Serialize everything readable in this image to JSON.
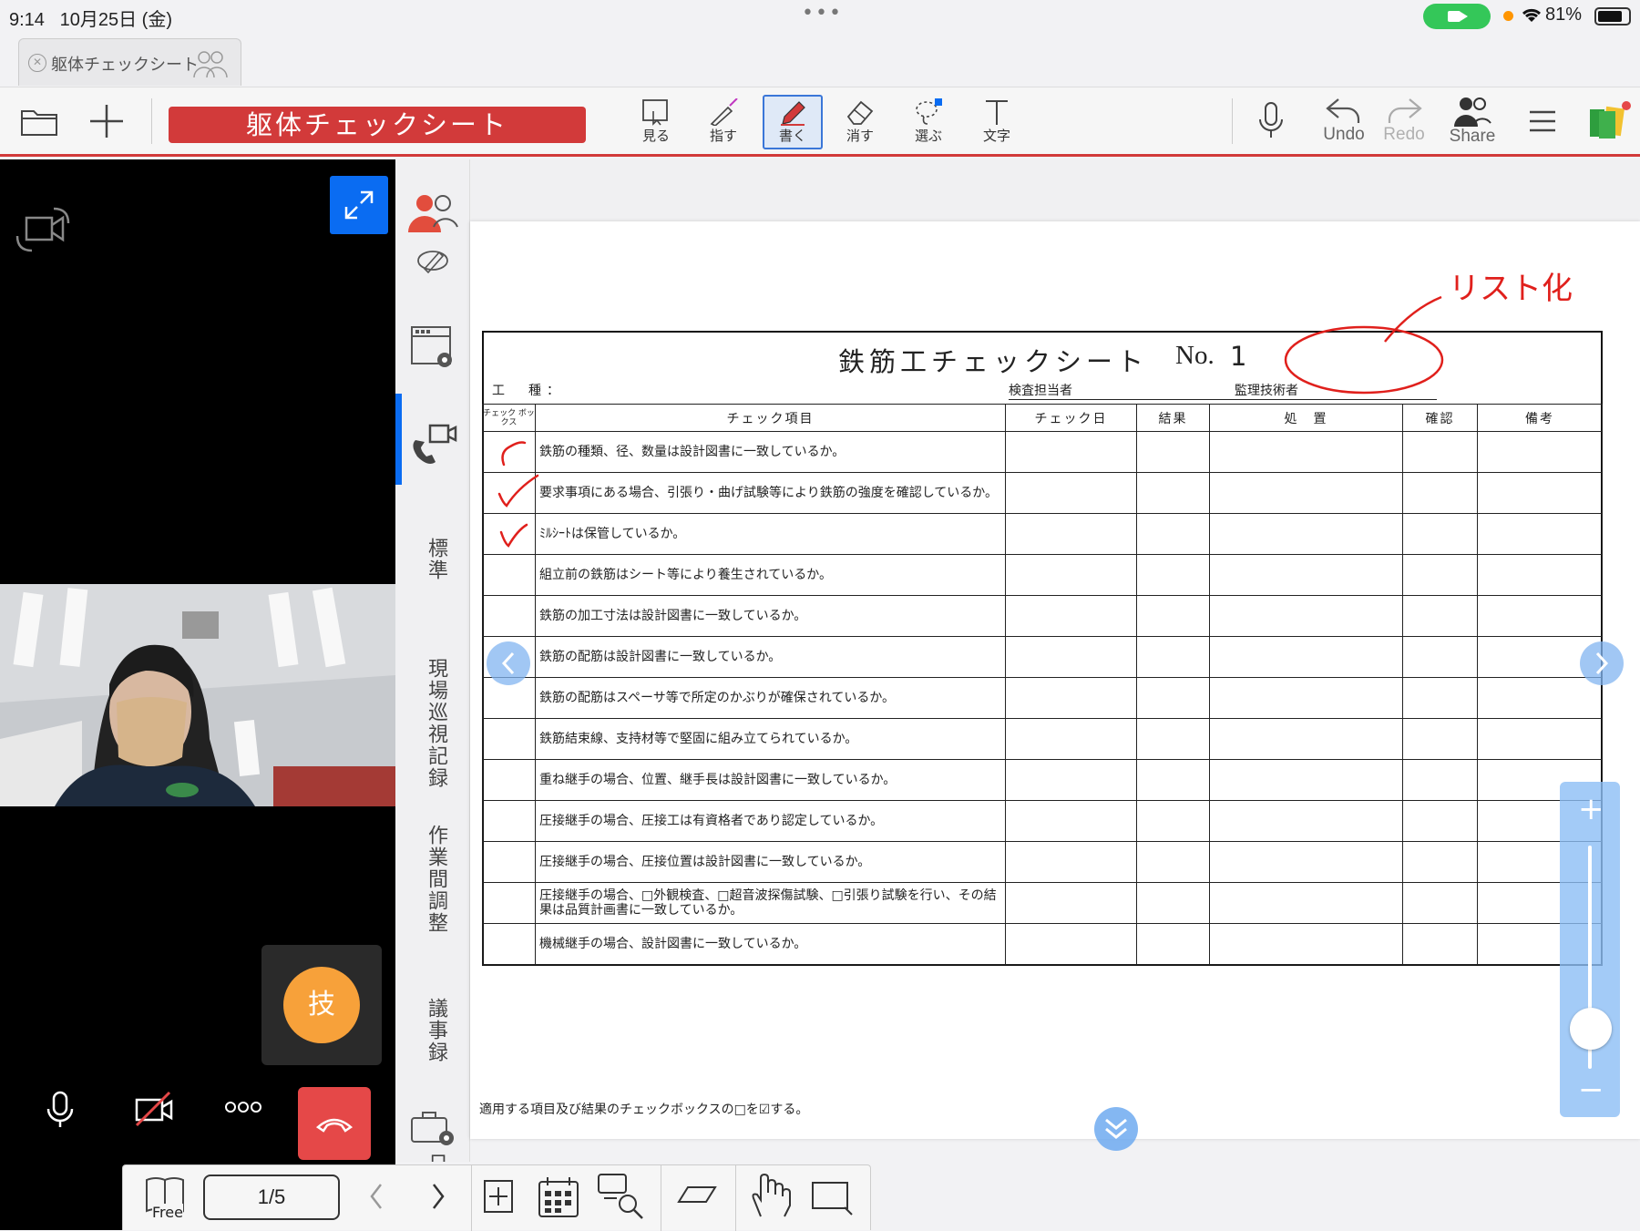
{
  "status_bar": {
    "time": "9:14",
    "date": "10月25日 (金)",
    "battery": "81%",
    "battery_fraction": 0.81,
    "multitask_dots": "•••"
  },
  "tab": {
    "label": "躯体チェックシート"
  },
  "toolbar": {
    "doc_title": "躯体チェックシート",
    "tools": {
      "view": "見る",
      "point": "指す",
      "write": "書く",
      "erase": "消す",
      "select": "選ぶ",
      "text": "文字"
    },
    "undo": "Undo",
    "redo": "Redo",
    "share": "Share",
    "accent_color": "#d23a3a",
    "active_tool_color": "#3a76d8"
  },
  "video": {
    "avatar_label": "技",
    "end_call_color": "#e54848"
  },
  "side_nav": {
    "labels": [
      "標準",
      "現場巡視記録",
      "作業間調整",
      "議事録",
      "日"
    ]
  },
  "sheet": {
    "title": "鉄筋工チェックシート",
    "no_label": "No.",
    "no_value": "1",
    "koushu_label": "工　種：",
    "kensa_label": "検査担当者",
    "kanri_label": "監理技術者",
    "headers": {
      "checkbox": "チェック ボックス",
      "item": "チェック項目",
      "date": "チェック日",
      "result": "結果",
      "action": "処　置",
      "confirm": "確認",
      "remarks": "備考"
    },
    "items": [
      {
        "text": "鉄筋の種類、径、数量は設計図書に一致しているか。",
        "checked": true
      },
      {
        "text": "要求事項にある場合、引張り・曲げ試験等により鉄筋の強度を確認しているか。",
        "checked": true
      },
      {
        "text": "ﾐﾙｼｰﾄは保管しているか。",
        "checked": true
      },
      {
        "text": "組立前の鉄筋はシート等により養生されているか。",
        "checked": false
      },
      {
        "text": "鉄筋の加工寸法は設計図書に一致しているか。",
        "checked": false
      },
      {
        "text": "鉄筋の配筋は設計図書に一致しているか。",
        "checked": false
      },
      {
        "text": "鉄筋の配筋はスペーサ等で所定のかぶりが確保されているか。",
        "checked": false
      },
      {
        "text": "鉄筋結束線、支持材等で堅固に組み立てられているか。",
        "checked": false
      },
      {
        "text": "重ね継手の場合、位置、継手長は設計図書に一致しているか。",
        "checked": false
      },
      {
        "text": "圧接継手の場合、圧接工は有資格者であり認定しているか。",
        "checked": false
      },
      {
        "text": "圧接継手の場合、圧接位置は設計図書に一致しているか。",
        "checked": false
      },
      {
        "text": "圧接継手の場合、□外観検査、□超音波探傷試験、□引張り試験を行い、その結果は品質計画書に一致しているか。",
        "checked": false
      },
      {
        "text": "機械継手の場合、設計図書に一致しているか。",
        "checked": false
      }
    ],
    "footnote": "適用する項目及び結果のチェックボックスの□を☑する。"
  },
  "annotation": {
    "handwritten": "リスト化",
    "ink_color": "#e0201c"
  },
  "bottom_bar": {
    "free_label": "Free",
    "page_indicator": "1/5"
  },
  "zoom": {
    "level_fraction": 0.1
  }
}
